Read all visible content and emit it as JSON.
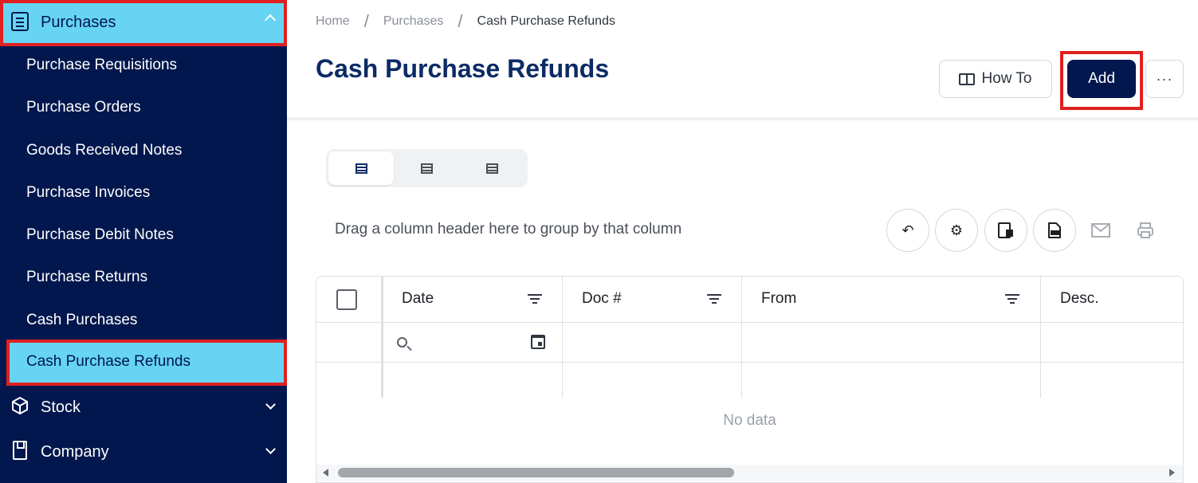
{
  "sidebar": {
    "section_purchases": "Purchases",
    "items": [
      {
        "label": "Purchase Requisitions"
      },
      {
        "label": "Purchase Orders"
      },
      {
        "label": "Goods Received Notes"
      },
      {
        "label": "Purchase Invoices"
      },
      {
        "label": "Purchase Debit Notes"
      },
      {
        "label": "Purchase Returns"
      },
      {
        "label": "Cash Purchases"
      },
      {
        "label": "Cash Purchase Refunds"
      }
    ],
    "active_item": "Cash Purchase Refunds",
    "section_stock": "Stock",
    "section_company": "Company"
  },
  "breadcrumb": {
    "home": "Home",
    "parent": "Purchases",
    "current": "Cash Purchase Refunds"
  },
  "header": {
    "title": "Cash Purchase Refunds",
    "howto_label": "How To",
    "add_label": "Add",
    "more_label": "···"
  },
  "toolbar": {
    "group_hint": "Drag a column header here to group by that column"
  },
  "grid": {
    "columns": [
      "Date",
      "Doc #",
      "From",
      "Desc."
    ],
    "empty_text": "No data"
  },
  "colors": {
    "sidebar_bg": "#01174d",
    "active_bg": "#66d4f2",
    "highlight": "#e02020",
    "title": "#0b2b66"
  }
}
